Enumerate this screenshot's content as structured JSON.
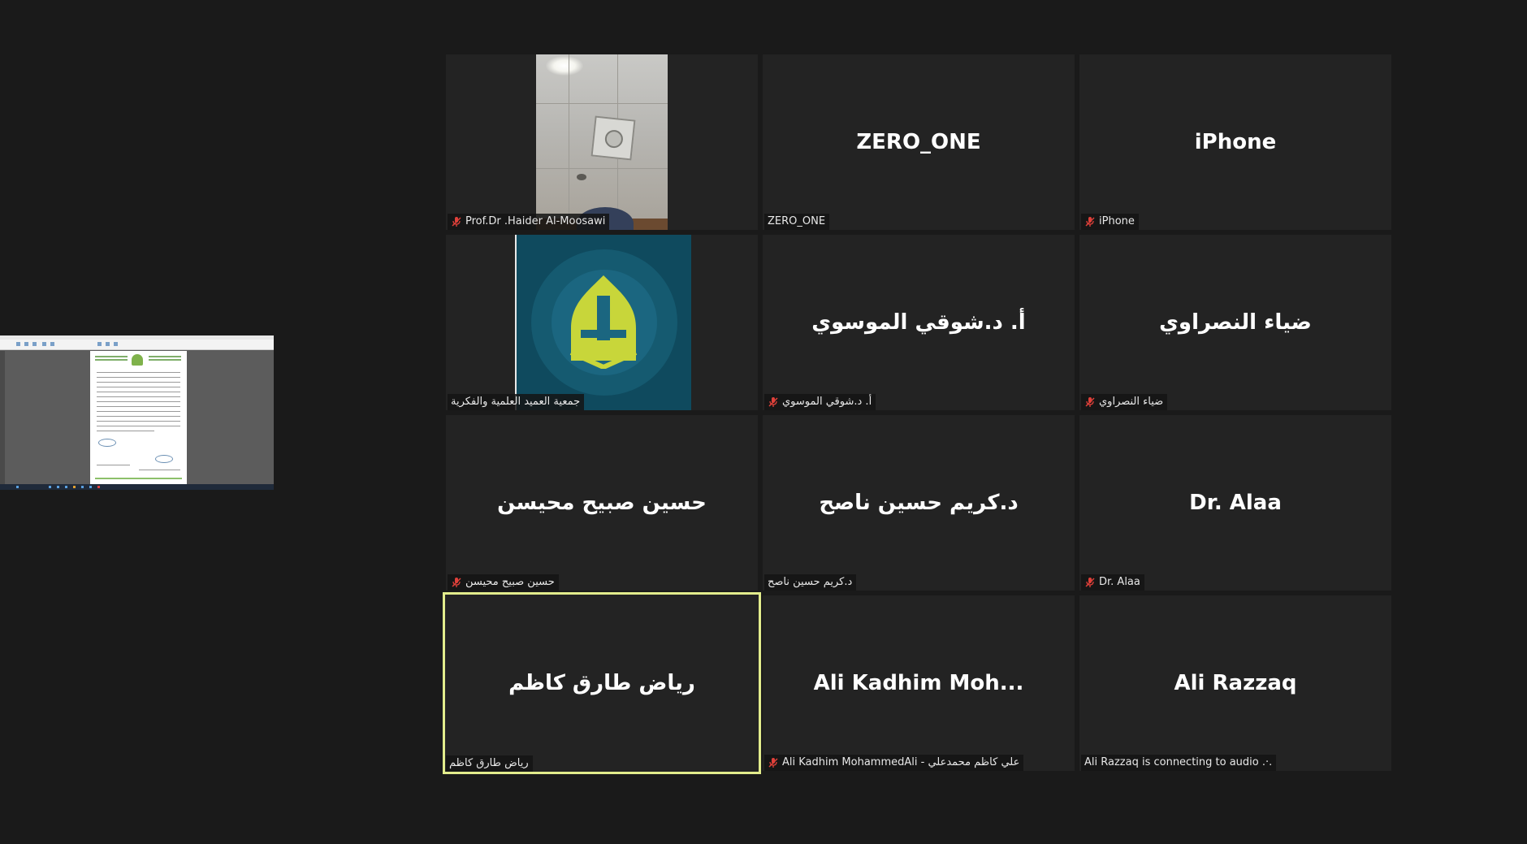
{
  "share_preview": {
    "label": "shared screen"
  },
  "tiles": [
    {
      "center": "",
      "tag": "Prof.Dr .Haider Al-Moosawi",
      "muted": true,
      "media": "video-ceiling"
    },
    {
      "center": "ZERO_ONE",
      "tag": "ZERO_ONE",
      "muted": false,
      "media": "none"
    },
    {
      "center": "iPhone",
      "tag": "iPhone",
      "muted": true,
      "media": "none"
    },
    {
      "center": "",
      "tag": "جمعية العميد العلمية والفكرية",
      "muted": false,
      "media": "logo-image"
    },
    {
      "center": "أ. د.شوقي الموسوي",
      "tag": "أ. د.شوقي الموسوي",
      "muted": true,
      "media": "none"
    },
    {
      "center": "ضياء النصراوي",
      "tag": "ضياء النصراوي",
      "muted": true,
      "media": "none"
    },
    {
      "center": "حسين صبيح محيسن",
      "tag": "حسين صبيح محيسن",
      "muted": true,
      "media": "none"
    },
    {
      "center": "د.كريم حسين ناصح",
      "tag": "د.كريم حسين ناصح",
      "muted": false,
      "media": "none"
    },
    {
      "center": "Dr. Alaa",
      "tag": "Dr. Alaa",
      "muted": true,
      "media": "none"
    },
    {
      "center": "رياض طارق كاظم",
      "tag": "رياض طارق كاظم",
      "muted": false,
      "media": "none",
      "active": true
    },
    {
      "center": "Ali  Kadhim Moh...",
      "tag": "Ali Kadhim MohammedAli - علي كاظم محمدعلي",
      "muted": true,
      "media": "none"
    },
    {
      "center": "Ali Razzaq",
      "tag": "Ali Razzaq is connecting to audio .·.",
      "muted": false,
      "media": "none"
    }
  ],
  "colors": {
    "background": "#1a1a1a",
    "tile": "#232323",
    "active_border": "#e2ec8c",
    "mute_icon": "#e0403a"
  },
  "icons": {
    "mute": "microphone-muted-icon"
  }
}
